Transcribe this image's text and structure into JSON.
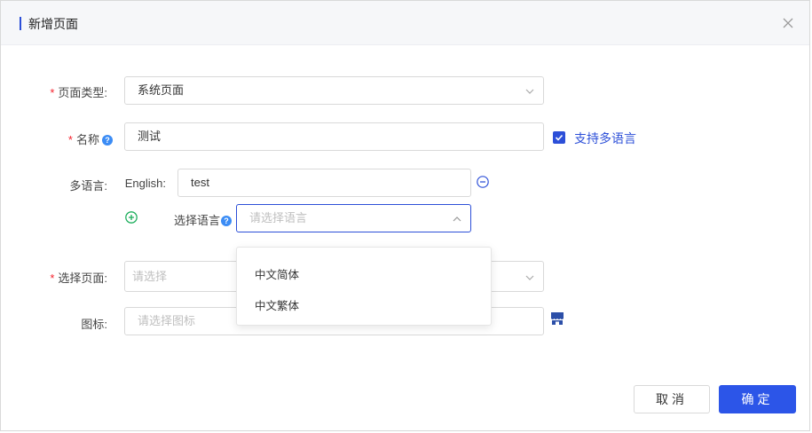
{
  "dialog": {
    "title": "新增页面"
  },
  "form": {
    "page_type": {
      "label": "页面类型:",
      "value": "系统页面"
    },
    "name": {
      "label": "名称",
      "value": "测试",
      "help": "?"
    },
    "multilang_checkbox": {
      "label": "支持多语言",
      "checked": true
    },
    "multilang": {
      "label": "多语言:",
      "english_label": "English:",
      "english_value": "test",
      "select_label": "选择语言",
      "select_placeholder": "请选择语言",
      "select_help": "?"
    },
    "select_page": {
      "label": "选择页面:",
      "placeholder": "请选择"
    },
    "icon": {
      "label": "图标:",
      "placeholder": "请选择图标"
    }
  },
  "language_dropdown": {
    "options": [
      "中文简体",
      "中文繁体"
    ]
  },
  "footer": {
    "cancel_label": "取消",
    "ok_label": "确定"
  },
  "colors": {
    "accent": "#2c4fd8",
    "required": "#f5222d",
    "add": "#1aad5a"
  },
  "icons": {
    "close": "close-icon",
    "chevron": "chevron-icon",
    "minus": "minus-circle-icon",
    "plus": "plus-circle-icon",
    "icon_picker": "store-icon"
  }
}
